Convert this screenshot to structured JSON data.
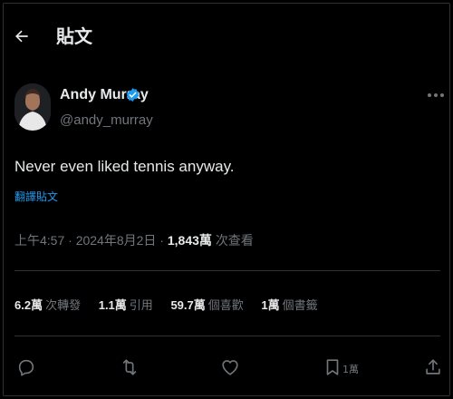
{
  "header": {
    "title": "貼文"
  },
  "author": {
    "name": "Andy Murray",
    "handle": "@andy_murray"
  },
  "tweet": {
    "text": "Never even liked tennis anyway.",
    "translate_label": "翻譯貼文",
    "time": "上午4:57",
    "date": "2024年8月2日",
    "views": "1,843萬",
    "views_label": "次查看"
  },
  "stats": [
    {
      "value": "6.2萬",
      "label": "次轉發"
    },
    {
      "value": "1.1萬",
      "label": "引用"
    },
    {
      "value": "59.7萬",
      "label": "個喜歡"
    },
    {
      "value": "1萬",
      "label": "個書籤"
    }
  ],
  "actions": {
    "bookmark_count": "1萬"
  },
  "icons": [
    "back-arrow-icon",
    "verified-badge-icon",
    "more-options-icon",
    "reply-icon",
    "retweet-icon",
    "like-icon",
    "bookmark-icon",
    "share-icon"
  ],
  "colors": {
    "background": "#000000",
    "text": "#e7e9ea",
    "muted": "#71767b",
    "accent": "#1d9bf0",
    "divider": "#2f3336"
  }
}
